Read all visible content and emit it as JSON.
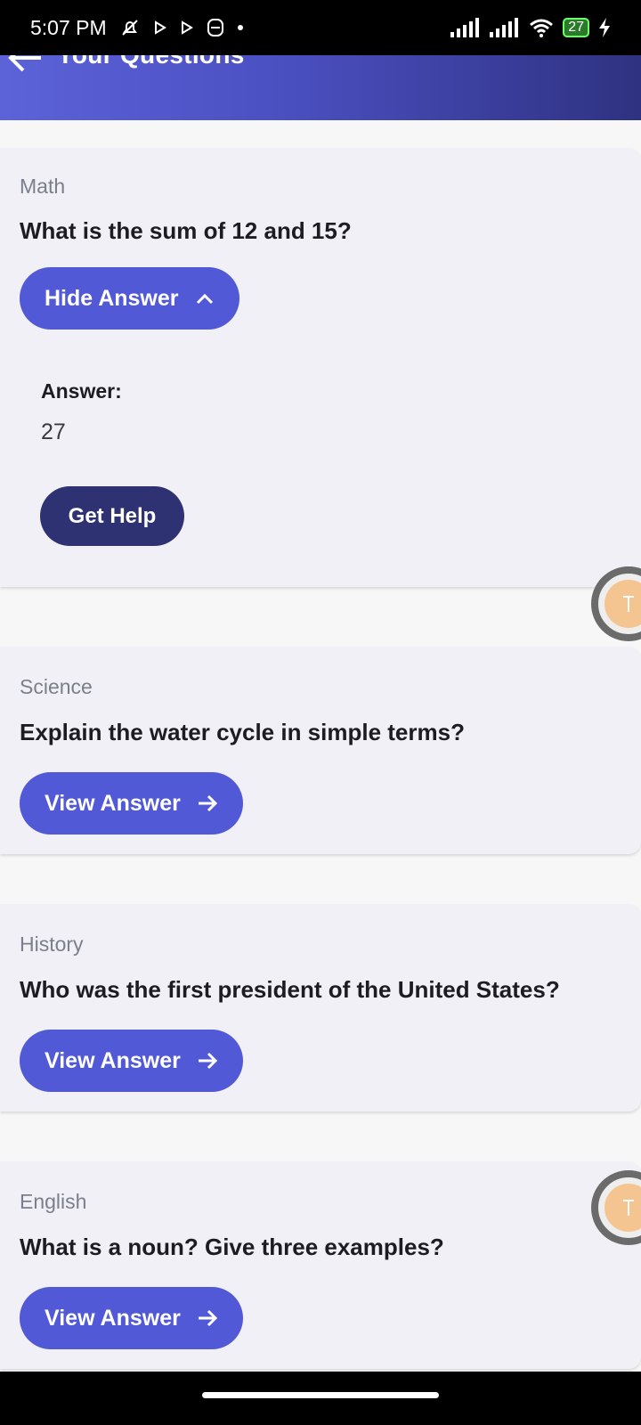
{
  "status_bar": {
    "time": "5:07 PM",
    "battery": "27",
    "icons": [
      "muted-bell-icon",
      "play-icon",
      "play-icon",
      "vpn-icon",
      "dot-icon",
      "signal-icon",
      "signal-icon",
      "wifi-icon",
      "battery-icon",
      "charging-icon"
    ]
  },
  "header": {
    "title": "Your Questions",
    "back_icon": "back-arrow-icon",
    "gradient": [
      "#5c63d8",
      "#2f3280"
    ]
  },
  "colors": {
    "primary_button": "#5159d6",
    "help_button": "#2f3272",
    "card_bg": "#f0f0f6",
    "subject_text": "#7b7f8c"
  },
  "questions": [
    {
      "subject": "Math",
      "question": "What is the sum of 12 and 15?",
      "button_label": "Hide Answer",
      "button_icon": "chevron-up-icon",
      "expanded": true,
      "answer_label": "Answer:",
      "answer": "27",
      "help_label": "Get Help"
    },
    {
      "subject": "Science",
      "question": "Explain the water cycle in simple terms?",
      "button_label": "View Answer",
      "button_icon": "arrow-right-icon",
      "expanded": false
    },
    {
      "subject": "History",
      "question": "Who was the first president of the United States?",
      "button_label": "View Answer",
      "button_icon": "arrow-right-icon",
      "expanded": false
    },
    {
      "subject": "English",
      "question": "What is a noun? Give three examples?",
      "button_label": "View Answer",
      "button_icon": "arrow-right-icon",
      "expanded": false
    }
  ]
}
